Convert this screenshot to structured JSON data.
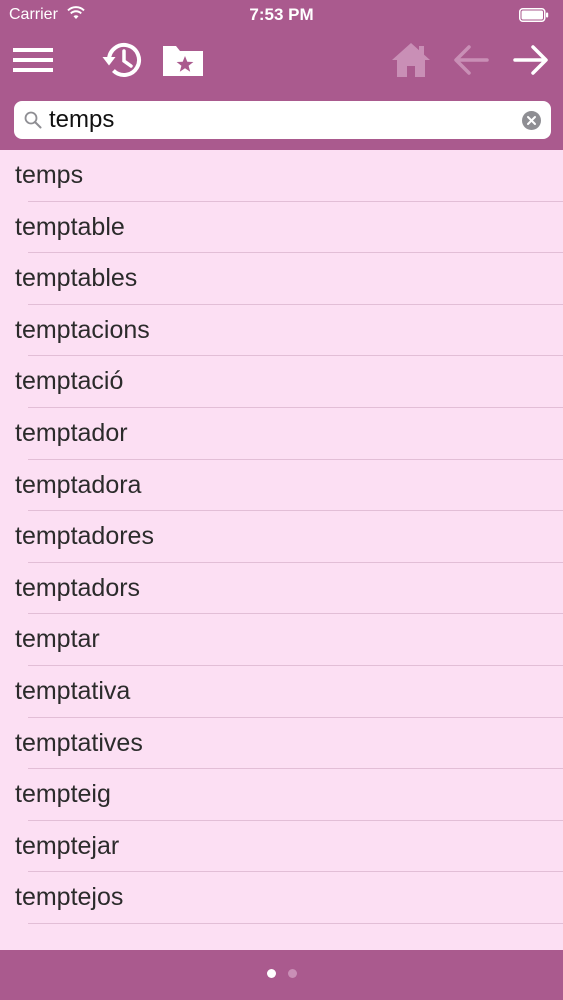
{
  "status_bar": {
    "carrier": "Carrier",
    "time": "7:53 PM"
  },
  "toolbar": {
    "menu_icon": "hamburger-menu-icon",
    "history_icon": "history-clock-icon",
    "favorites_icon": "folder-star-icon",
    "home_icon": "home-icon",
    "back_icon": "arrow-left-icon",
    "forward_icon": "arrow-right-icon"
  },
  "search": {
    "value": "temps",
    "placeholder": ""
  },
  "word_list": {
    "items": [
      "temps",
      "temptable",
      "temptables",
      "temptacions",
      "temptació",
      "temptador",
      "temptadora",
      "temptadores",
      "temptadors",
      "temptar",
      "temptativa",
      "temptatives",
      "tempteig",
      "temptejar",
      "temptejos"
    ]
  },
  "pager": {
    "pages": 2,
    "current": 1
  },
  "colors": {
    "header_bg": "#aa5a8e",
    "list_bg": "#fcdff3",
    "separator": "#e2bed6",
    "disabled_icon": "#c98fb6"
  }
}
